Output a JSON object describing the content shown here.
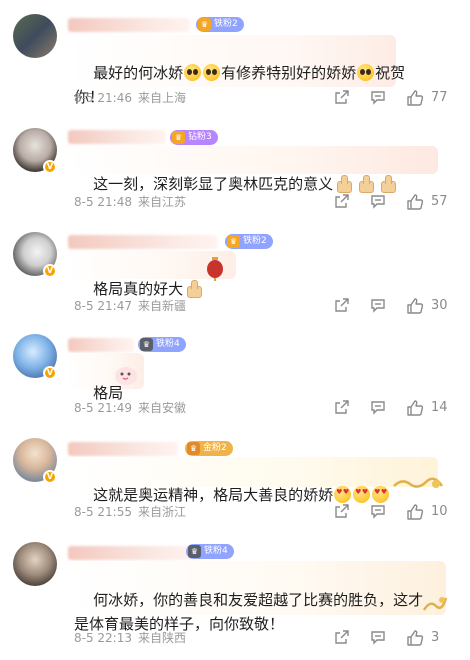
{
  "comments": [
    {
      "badge": "铁粉2",
      "badge_color": "#8fa3ff",
      "text": "最好的何冰娇",
      "text_mid": "有修养特别好的娇娇",
      "text_end": "祝贺",
      "text_line2": "你！",
      "date": "8-5 21:46",
      "location": "来自上海",
      "likes": "77"
    },
    {
      "badge": "钻粉3",
      "badge_color": "#b785ff",
      "text": "这一刻，深刻彰显了奥林匹克的意义",
      "date": "8-5 21:48",
      "location": "来自江苏",
      "likes": "57"
    },
    {
      "badge": "铁粉2",
      "badge_color": "#8fa3ff",
      "text": "格局真的好大",
      "date": "8-5 21:47",
      "location": "来自新疆",
      "likes": "30"
    },
    {
      "badge": "铁粉4",
      "badge_color": "#8fa3ff",
      "text": "格局",
      "date": "8-5 21:49",
      "location": "来自安徽",
      "likes": "14"
    },
    {
      "badge": "金粉2",
      "badge_color": "#f0b34a",
      "text": "这就是奥运精神，格局大善良的娇娇",
      "date": "8-5 21:55",
      "location": "来自浙江",
      "likes": "10"
    },
    {
      "badge": "铁粉4",
      "badge_color": "#8fa3ff",
      "text": "何冰娇，你的善良和友爱超越了比赛的胜负，这才",
      "text_line2": "是体育最美的样子，向你致敬！",
      "date": "8-5 22:13",
      "location": "来自陕西",
      "likes": "3"
    }
  ]
}
